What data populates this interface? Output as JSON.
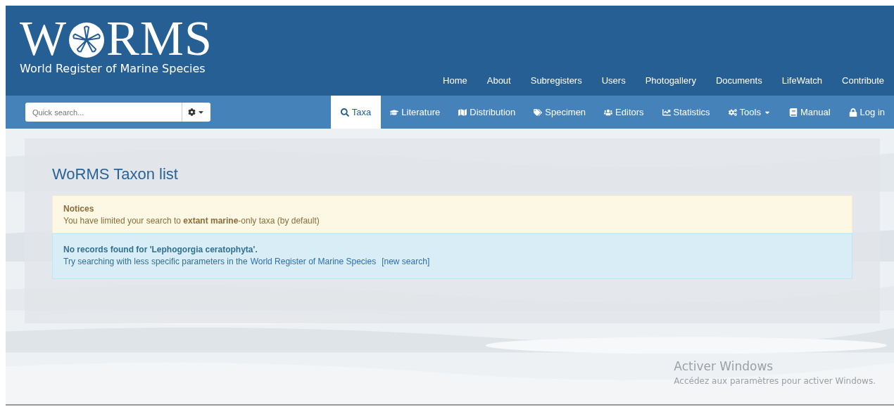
{
  "logo": {
    "letter_before": "W",
    "letters_after": "RMS",
    "tagline": "World Register of Marine Species"
  },
  "top_nav": [
    "Home",
    "About",
    "Subregisters",
    "Users",
    "Photogallery",
    "Documents",
    "LifeWatch",
    "Contribute"
  ],
  "search": {
    "placeholder": "Quick search..."
  },
  "tabs": [
    {
      "label": "Taxa",
      "selected": true,
      "has_menu": false
    },
    {
      "label": "Literature",
      "selected": false,
      "has_menu": false
    },
    {
      "label": "Distribution",
      "selected": false,
      "has_menu": false
    },
    {
      "label": "Specimen",
      "selected": false,
      "has_menu": false
    },
    {
      "label": "Editors",
      "selected": false,
      "has_menu": false
    },
    {
      "label": "Statistics",
      "selected": false,
      "has_menu": false
    },
    {
      "label": "Tools",
      "selected": false,
      "has_menu": true
    },
    {
      "label": "Manual",
      "selected": false,
      "has_menu": false
    },
    {
      "label": "Log in",
      "selected": false,
      "has_menu": false
    }
  ],
  "page_title": "WoRMS Taxon list",
  "notice": {
    "title": "Notices",
    "text": "You have limited your search to **extant marine**-only taxa (by default)"
  },
  "result": {
    "title": "No records found for 'Lephogorgia ceratophyta'.",
    "text": "Try searching with less specific parameters in the",
    "link": "World Register of Marine Species",
    "new_search": "[new search]"
  },
  "activation": {
    "title": "Activer Windows",
    "text": "Accédez aux paramètres pour activer Windows."
  }
}
